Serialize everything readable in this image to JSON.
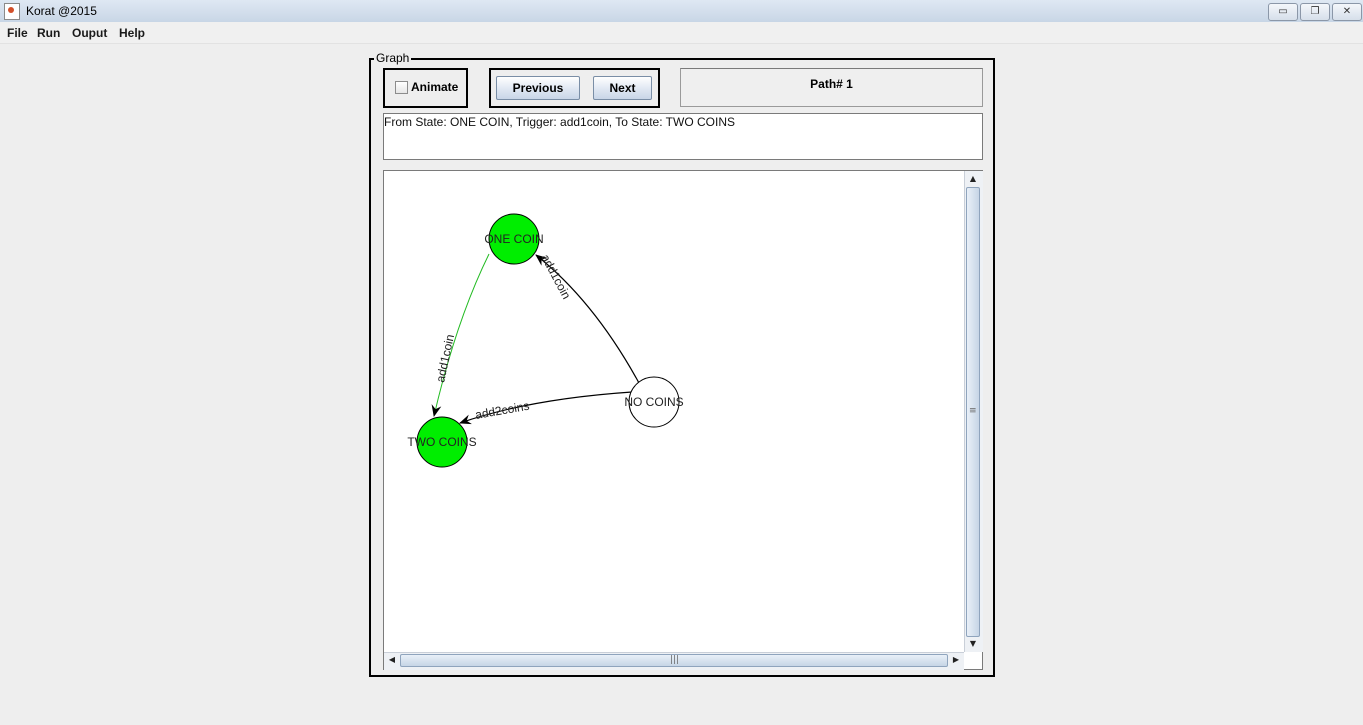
{
  "window": {
    "title": "Korat @2015",
    "controls": {
      "minimize": "▭",
      "maximize": "❐",
      "close": "✕"
    }
  },
  "menu": [
    "File",
    "Run",
    "Ouput",
    "Help"
  ],
  "graph_panel": {
    "legend": "Graph",
    "animate_label": "Animate",
    "animate_checked": false,
    "previous_label": "Previous",
    "next_label": "Next",
    "path_label": "Path# 1",
    "status_text": "From State: ONE COIN, Trigger: add1coin, To State: TWO COINS"
  },
  "graph": {
    "states": [
      {
        "id": "one",
        "label": "ONE COIN",
        "highlighted": true
      },
      {
        "id": "two",
        "label": "TWO COINS",
        "highlighted": true
      },
      {
        "id": "none",
        "label": "NO COINS",
        "highlighted": false
      }
    ],
    "transitions": [
      {
        "from": "one",
        "to": "two",
        "trigger": "add1coin",
        "highlighted": true
      },
      {
        "from": "none",
        "to": "one",
        "trigger": "add1coin",
        "highlighted": false
      },
      {
        "from": "none",
        "to": "two",
        "trigger": "add2coins",
        "highlighted": false
      }
    ],
    "colors": {
      "highlight_fill": "#00ee00",
      "normal_fill": "#ffffff",
      "highlight_edge": "#22bb22",
      "edge": "#000000"
    }
  }
}
